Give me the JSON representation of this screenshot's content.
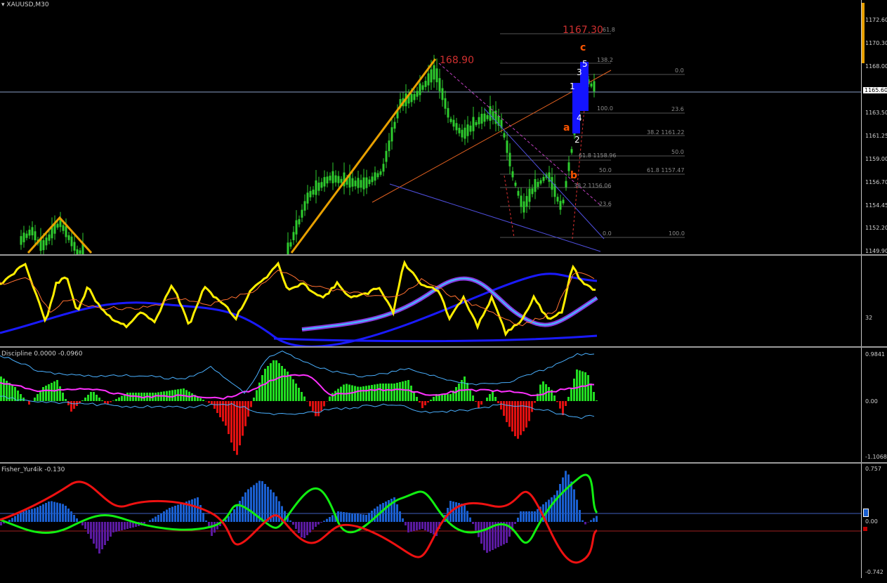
{
  "window": {
    "symbol_title": "XAUUSD,M30",
    "menu_icon": "triangle-down-icon"
  },
  "main_pane": {
    "price_labels": [
      "1172.60",
      "1170.30",
      "1168.00",
      "1165.60",
      "1163.50",
      "1161.25",
      "1159.00",
      "1156.70",
      "1154.45",
      "1152.20",
      "1149.90"
    ],
    "current_price": "1165.60",
    "high_label": "168.90",
    "target_label": "1167.30",
    "wave_labels": {
      "c": "c",
      "a": "a",
      "b": "b",
      "w5": "5",
      "w3": "3",
      "w1": "1",
      "w4": "4",
      "w2": "2"
    },
    "fib_top": {
      "l1618": "61.8",
      "l1382": "138.2",
      "l00": "0.0",
      "l236": "23.6",
      "l382": "38.2 1161.22",
      "l50": "50.0",
      "l618": "61.8 1157.47",
      "l1000": "100.0"
    },
    "fib_mid": {
      "l100": "100.0",
      "l618": "61.8 1158.96",
      "l50": "50.0",
      "l382": "38.2 1156.06",
      "l236": "23.6",
      "l00": "0.0"
    }
  },
  "pane2": {
    "axis_label": "32"
  },
  "pane3": {
    "title": "Discipline 0.0000 -0.0960",
    "labels": [
      "0.9841",
      "0.00",
      "-1.1068"
    ]
  },
  "pane4": {
    "title": "Fisher_Yur4ik -0.130",
    "labels": [
      "0.757",
      "0.00",
      "-0.742"
    ]
  },
  "colors": {
    "bull_candle": "#2ecc2e",
    "up_histogram": "#22dd22",
    "down_histogram": "#e01010",
    "fisher_up": "#11ee11",
    "fisher_down": "#ee1111",
    "blue_bars": "#1a5fd0",
    "purple_bars": "#5a1aa0",
    "signal_yellow": "#ffee00",
    "accent_orange": "#e8a000"
  }
}
